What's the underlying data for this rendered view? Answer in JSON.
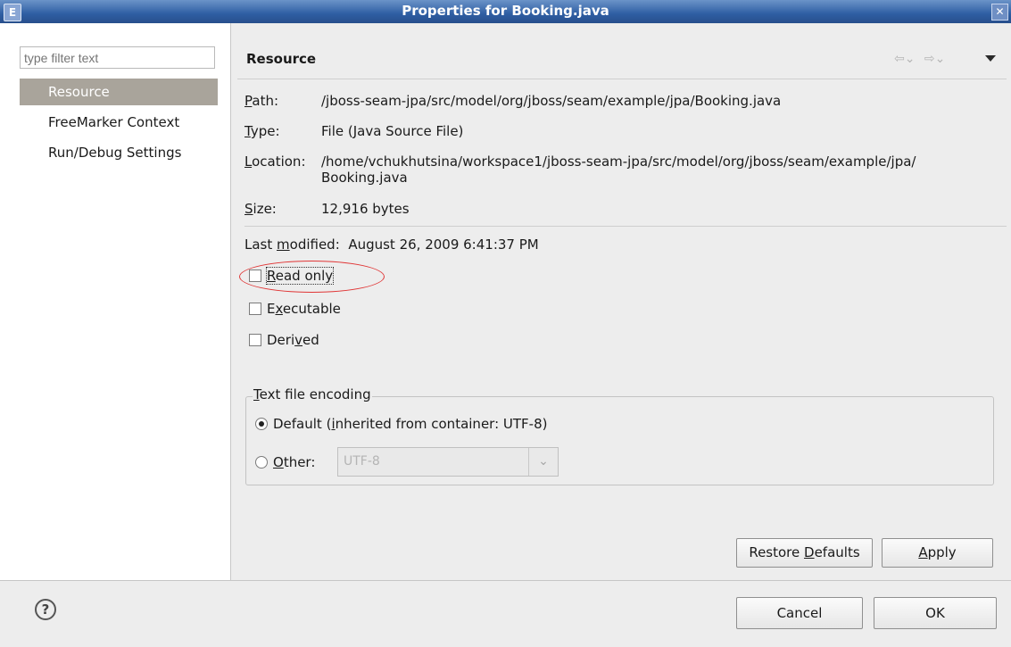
{
  "window": {
    "title": "Properties for Booking.java",
    "close_glyph": "✕",
    "app_icon_glyph": "E"
  },
  "sidebar": {
    "filter_placeholder": "type filter text",
    "items": [
      {
        "label": "Resource",
        "selected": true
      },
      {
        "label": "FreeMarker Context",
        "selected": false
      },
      {
        "label": "Run/Debug Settings",
        "selected": false
      }
    ]
  },
  "page": {
    "heading": "Resource",
    "back_glyph": "⇦⌄",
    "forward_glyph": "⇨⌄"
  },
  "properties": {
    "path_label_mn": "P",
    "path_label_rest": "ath:",
    "path_value": "/jboss-seam-jpa/src/model/org/jboss/seam/example/jpa/Booking.java",
    "type_label_mn": "T",
    "type_label_rest": "ype:",
    "type_value": "File  (Java Source File)",
    "location_label_mn": "L",
    "location_label_rest": "ocation:",
    "location_value_line1": "/home/vchukhutsina/workspace1/jboss-seam-jpa/src/model/org/jboss/seam/example/jpa/",
    "location_value_line2": "Booking.java",
    "size_label_mn": "S",
    "size_label_rest": "ize:",
    "size_value": "12,916  bytes",
    "modified_label_pre": "Last ",
    "modified_label_mn": "m",
    "modified_label_post": "odified:",
    "modified_value": "August 26, 2009 6:41:37 PM"
  },
  "attributes": {
    "read_only_mn": "R",
    "read_only_rest": "ead only",
    "read_only_checked": false,
    "executable_pre": "E",
    "executable_mn": "x",
    "executable_post": "ecutable",
    "executable_checked": false,
    "derived_pre": "Deri",
    "derived_mn": "v",
    "derived_post": "ed",
    "derived_checked": false
  },
  "encoding": {
    "legend_mn": "T",
    "legend_rest": "ext file encoding",
    "default_pre": "Default (",
    "default_mn": "i",
    "default_post": "nherited from container: UTF-8)",
    "default_selected": true,
    "other_mn": "O",
    "other_rest": "ther:",
    "other_selected": false,
    "other_value": "UTF-8",
    "dropdown_glyph": "⌄"
  },
  "buttons": {
    "restore_pre": "Restore ",
    "restore_mn": "D",
    "restore_post": "efaults",
    "apply_mn": "A",
    "apply_rest": "pply",
    "cancel": "Cancel",
    "ok": "OK"
  },
  "footer": {
    "help_glyph": "?"
  }
}
